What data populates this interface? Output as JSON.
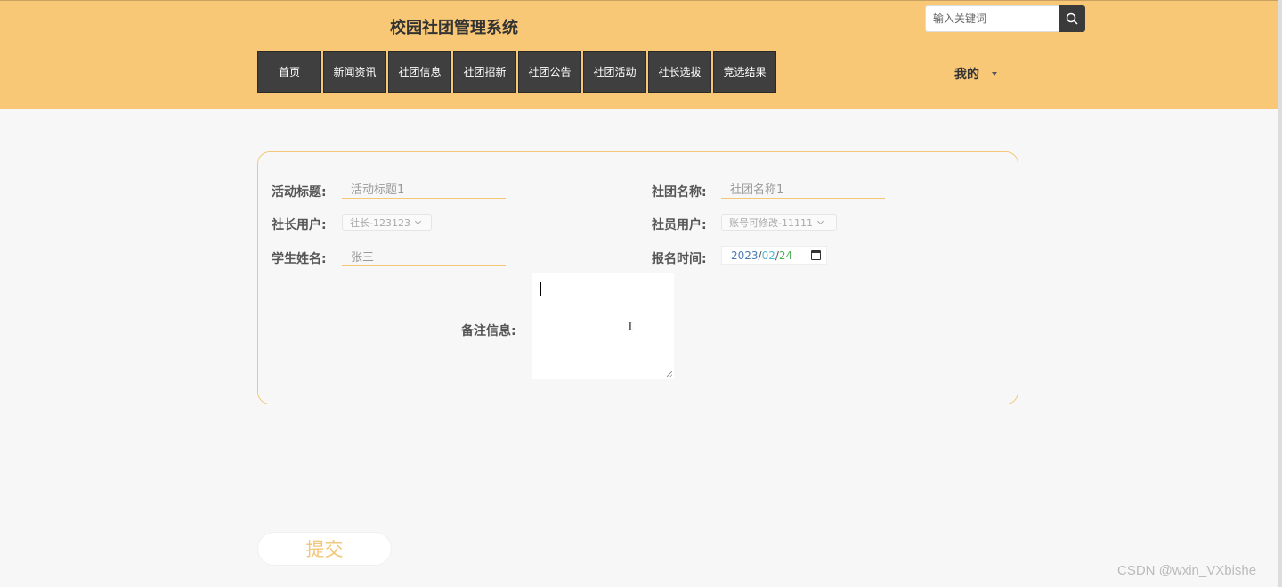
{
  "header": {
    "title": "校园社团管理系统",
    "search": {
      "placeholder": "输入关键词",
      "value": ""
    },
    "icons": {
      "search": "search-icon"
    },
    "nav": [
      {
        "label": "首页"
      },
      {
        "label": "新闻资讯"
      },
      {
        "label": "社团信息"
      },
      {
        "label": "社团招新"
      },
      {
        "label": "社团公告"
      },
      {
        "label": "社团活动"
      },
      {
        "label": "社长选拔"
      },
      {
        "label": "竞选结果"
      }
    ],
    "user_menu": {
      "label": "我的"
    },
    "colors": {
      "header_bg": "#f9c877",
      "nav_bg": "#3f3f3f",
      "accent": "#f3c77a"
    }
  },
  "form": {
    "activity_title": {
      "label": "活动标题:",
      "value": "活动标题1"
    },
    "club_name": {
      "label": "社团名称:",
      "value": "社团名称1"
    },
    "president_user": {
      "label": "社长用户:",
      "value": "社长-123123"
    },
    "member_user": {
      "label": "社员用户:",
      "value": "账号可修改-11111"
    },
    "student_name": {
      "label": "学生姓名:",
      "value": "张三"
    },
    "signup_time": {
      "label": "报名时间:",
      "year": "2023",
      "month": "02",
      "day": "24",
      "sep": "/"
    },
    "remarks": {
      "label": "备注信息:",
      "value": ""
    }
  },
  "submit": {
    "label": "提交"
  },
  "watermark": "CSDN @wxin_VXbishe"
}
